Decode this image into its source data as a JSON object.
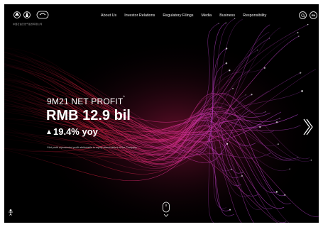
{
  "header": {
    "logo_alt": "PetroChina logo",
    "logo_caption": "中国石油天然气股份有限公司",
    "nav": [
      {
        "label": "About Us"
      },
      {
        "label": "Investor Relations"
      },
      {
        "label": "Regulatory Filings"
      },
      {
        "label": "Media"
      },
      {
        "label": "Business"
      },
      {
        "label": "Responsibility"
      }
    ],
    "search_icon": "search-icon",
    "lang_label": "EN"
  },
  "hero": {
    "kicker": "9M21 NET PROFIT",
    "kicker_mark": "*",
    "headline": "RMB 12.9 bil",
    "growth": "19.4% yoy",
    "footnote": "*Net profit represented profit attributable to equity shareholders of the Company",
    "next_icon": "chevron-right-icon",
    "scroll_icon": "mouse-scroll-icon"
  },
  "colors": {
    "background": "#000000",
    "accent_pink": "#e0309a",
    "accent_red": "#e0203c",
    "accent_purple": "#b040d0"
  }
}
